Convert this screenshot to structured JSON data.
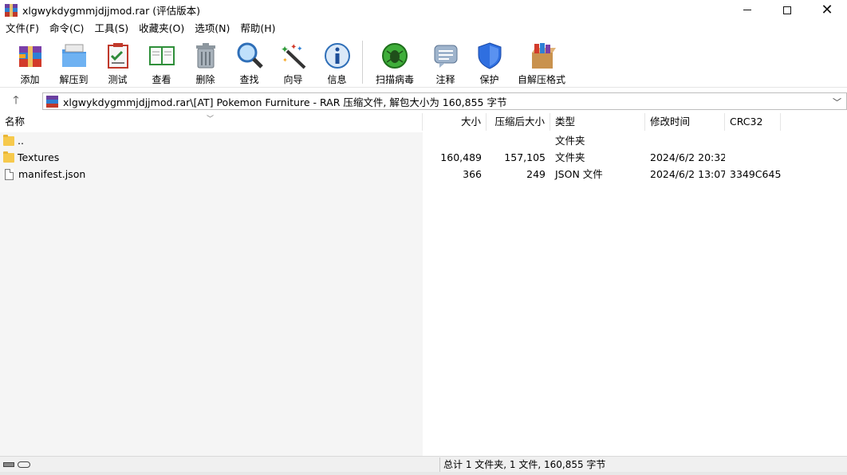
{
  "window": {
    "title": "xlgwykdygmmjdjjmod.rar (评估版本)"
  },
  "menu": [
    "文件(F)",
    "命令(C)",
    "工具(S)",
    "收藏夹(O)",
    "选项(N)",
    "帮助(H)"
  ],
  "toolbar": [
    {
      "label": "添加",
      "icon": "add-archive-icon"
    },
    {
      "label": "解压到",
      "icon": "extract-to-icon"
    },
    {
      "label": "测试",
      "icon": "test-icon"
    },
    {
      "label": "查看",
      "icon": "view-icon"
    },
    {
      "label": "删除",
      "icon": "delete-icon"
    },
    {
      "label": "查找",
      "icon": "find-icon"
    },
    {
      "label": "向导",
      "icon": "wizard-icon"
    },
    {
      "label": "信息",
      "icon": "info-icon"
    },
    {
      "label": "扫描病毒",
      "icon": "virus-scan-icon"
    },
    {
      "label": "注释",
      "icon": "comment-icon"
    },
    {
      "label": "保护",
      "icon": "protect-icon"
    },
    {
      "label": "自解压格式",
      "icon": "sfx-icon"
    }
  ],
  "address": {
    "path": "xlgwykdygmmjdjjmod.rar\\[AT] Pokemon Furniture - RAR 压缩文件, 解包大小为 160,855 字节"
  },
  "columns": {
    "name": "名称",
    "size": "大小",
    "packed": "压缩后大小",
    "type": "类型",
    "modified": "修改时间",
    "crc": "CRC32"
  },
  "files": [
    {
      "name": "..",
      "size": "",
      "packed": "",
      "type": "文件夹",
      "modified": "",
      "crc": "",
      "kind": "folder"
    },
    {
      "name": "Textures",
      "size": "160,489",
      "packed": "157,105",
      "type": "文件夹",
      "modified": "2024/6/2 20:32",
      "crc": "",
      "kind": "folder"
    },
    {
      "name": "manifest.json",
      "size": "366",
      "packed": "249",
      "type": "JSON 文件",
      "modified": "2024/6/2 13:07",
      "crc": "3349C645",
      "kind": "file"
    }
  ],
  "status": {
    "text": "总计 1 文件夹, 1 文件, 160,855 字节"
  }
}
